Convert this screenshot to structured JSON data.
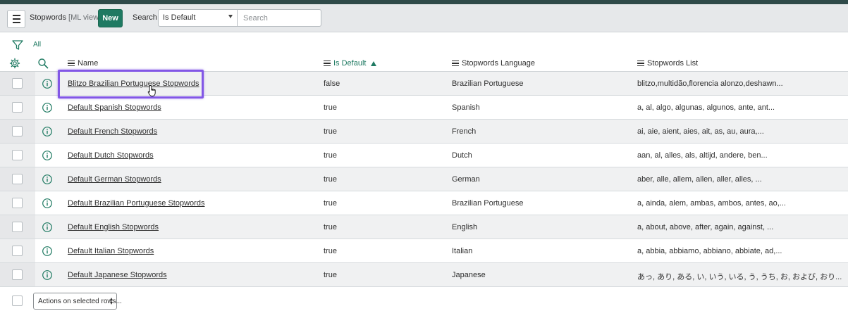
{
  "toolbar": {
    "title": "Stopwords",
    "subtitle": "[ML view]",
    "new_label": "New",
    "search_label": "Search",
    "search_field": "Is Default",
    "search_placeholder": "Search"
  },
  "filter": {
    "label": "All"
  },
  "columns": {
    "name": "Name",
    "is_default": "Is Default",
    "language": "Stopwords Language",
    "list": "Stopwords List"
  },
  "sort": {
    "column": "is_default",
    "direction": "ascending"
  },
  "rows": [
    {
      "name": "Blitzo Brazilian Portuguese Stopwords",
      "is_default": "false",
      "language": "Brazilian Portuguese",
      "list": "blitzo,multidão,florencia alonzo,deshawn..."
    },
    {
      "name": "Default Spanish Stopwords",
      "is_default": "true",
      "language": "Spanish",
      "list": "a, al, algo, algunas, algunos, ante, ant..."
    },
    {
      "name": "Default French Stopwords",
      "is_default": "true",
      "language": "French",
      "list": "ai, aie, aient, aies, ait, as, au, aura,..."
    },
    {
      "name": "Default Dutch Stopwords",
      "is_default": "true",
      "language": "Dutch",
      "list": "aan, al, alles, als, altijd, andere, ben..."
    },
    {
      "name": "Default German Stopwords",
      "is_default": "true",
      "language": "German",
      "list": "aber, alle, allem, allen, aller, alles, ..."
    },
    {
      "name": "Default Brazilian Portuguese Stopwords",
      "is_default": "true",
      "language": "Brazilian Portuguese",
      "list": "a, ainda, alem, ambas, ambos, antes, ao,..."
    },
    {
      "name": "Default English Stopwords",
      "is_default": "true",
      "language": "English",
      "list": "a, about, above, after, again, against, ..."
    },
    {
      "name": "Default Italian Stopwords",
      "is_default": "true",
      "language": "Italian",
      "list": "a, abbia, abbiamo, abbiano, abbiate, ad,..."
    },
    {
      "name": "Default Japanese Stopwords",
      "is_default": "true",
      "language": "Japanese",
      "list": "あっ, あり, ある, い, いう, いる, う, うち, お, および, おり..."
    }
  ],
  "footer": {
    "actions_label": "Actions on selected rows..."
  },
  "colors": {
    "accent": "#1f7a62",
    "highlight": "#8257e6"
  }
}
